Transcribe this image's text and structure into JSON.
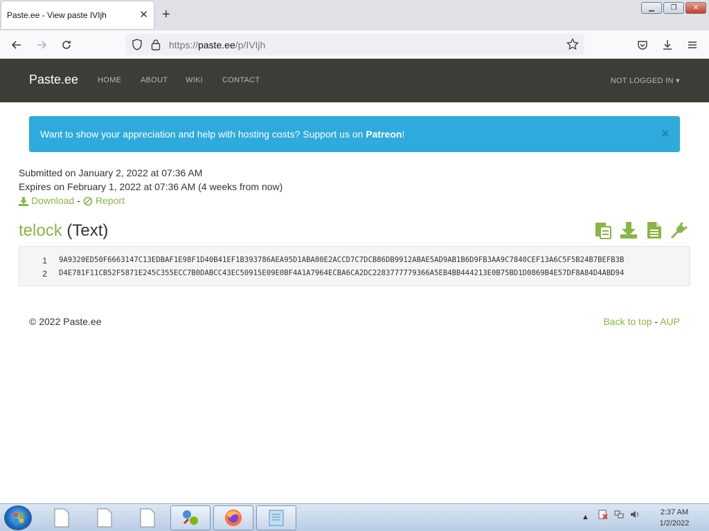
{
  "browser": {
    "tab_title": "Paste.ee - View paste IVIjh",
    "url_prefix": "https://",
    "url_host": "paste.ee",
    "url_path": "/p/IVIjh"
  },
  "site": {
    "brand": "Paste.ee",
    "nav": [
      "HOME",
      "ABOUT",
      "WIKI",
      "CONTACT"
    ],
    "user_menu": "NOT LOGGED IN"
  },
  "alert": {
    "text": "Want to show your appreciation and help with hosting costs? Support us on ",
    "link": "Patreon",
    "suffix": "!",
    "close": "×"
  },
  "paste": {
    "submitted": "Submitted on January 2, 2022 at 07:36 AM",
    "expires": "Expires on February 1, 2022 at 07:36 AM (4 weeks from now)",
    "download": "Download",
    "separator": "-",
    "report": "Report",
    "name": "telock",
    "type": "(Text)",
    "lines": [
      {
        "n": "1",
        "text": "9A9320ED50F6663147C13EDBAF1E98F1D40B41EF1B393786AEA95D1ABA80E2ACCD7C7DCB86DB9912ABAE5AD9AB1B6D9FB3AA9C7840CEF13A6C5F5B24B7BEFB3B"
      },
      {
        "n": "2",
        "text": "D4E781F11CB52F5871E245C355ECC7B0DABCC43EC50915E09E0BF4A1A7964ECBA6CA2DC2283777779366A5EB4BB444213E0B75BD1D0869B4E57DF8A84D4ABD94"
      }
    ]
  },
  "footer": {
    "copyright": "© 2022 Paste.ee",
    "back_to_top": "Back to top",
    "separator": "-",
    "aup": "AUP"
  },
  "taskbar": {
    "time": "2:37 AM",
    "date": "1/2/2022"
  },
  "colors": {
    "accent_green": "#8ab547",
    "alert_blue": "#2eaadc",
    "header_dark": "#3d3d38"
  }
}
